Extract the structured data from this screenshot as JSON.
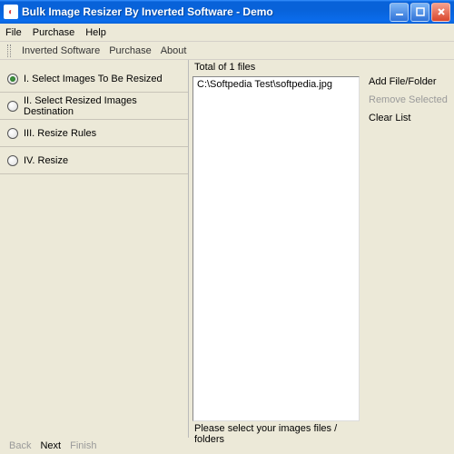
{
  "window": {
    "title": "Bulk Image Resizer By Inverted Software - Demo"
  },
  "menubar": {
    "file": "File",
    "purchase": "Purchase",
    "help": "Help"
  },
  "submenu": {
    "inverted": "Inverted Software",
    "purchase": "Purchase",
    "about": "About"
  },
  "steps": {
    "items": [
      {
        "label": "I. Select Images To Be Resized",
        "selected": true
      },
      {
        "label": "II. Select Resized Images Destination",
        "selected": false
      },
      {
        "label": "III. Resize Rules",
        "selected": false
      },
      {
        "label": "IV. Resize",
        "selected": false
      }
    ]
  },
  "filepane": {
    "total": "Total of 1 files",
    "files": [
      "C:\\Softpedia Test\\softpedia.jpg"
    ],
    "instruction": "Please select your images files / folders"
  },
  "actions": {
    "add": "Add File/Folder",
    "remove": "Remove Selected",
    "clear": "Clear List"
  },
  "nav": {
    "back": "Back",
    "next": "Next",
    "finish": "Finish"
  }
}
